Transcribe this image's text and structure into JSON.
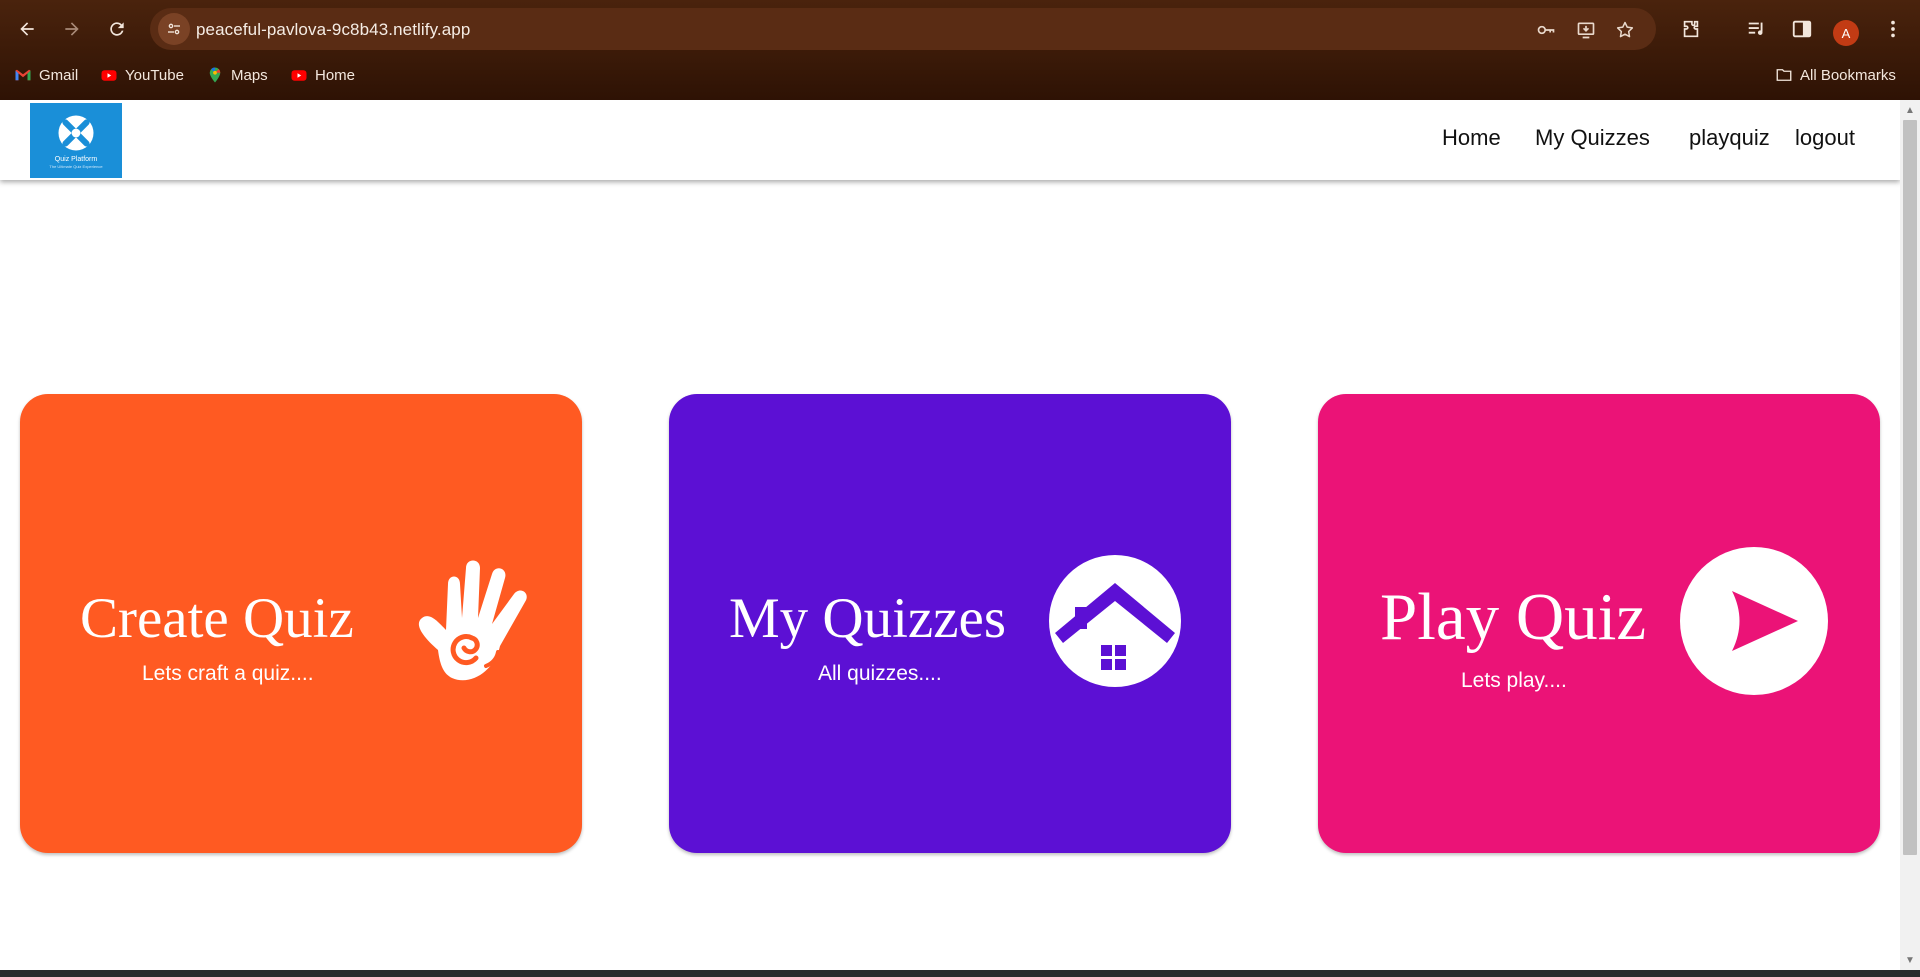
{
  "browser": {
    "url": "peaceful-pavlova-9c8b43.netlify.app",
    "avatar_letter": "A",
    "bookmarks": [
      {
        "label": "Gmail",
        "icon": "gmail-icon"
      },
      {
        "label": "YouTube",
        "icon": "youtube-icon"
      },
      {
        "label": "Maps",
        "icon": "maps-icon"
      },
      {
        "label": "Home",
        "icon": "youtube-icon"
      }
    ],
    "all_bookmarks_label": "All Bookmarks"
  },
  "header": {
    "logo_text": "Quiz Platform",
    "logo_tagline": "The Ultimate Quiz Experience",
    "nav": [
      {
        "label": "Home"
      },
      {
        "label": "My Quizzes"
      },
      {
        "label": "playquiz"
      },
      {
        "label": "logout"
      }
    ]
  },
  "cards": [
    {
      "title": "Create Quiz",
      "subtitle": "Lets craft a quiz....",
      "color": "#ff5a22",
      "icon": "hand-icon"
    },
    {
      "title": "My Quizzes",
      "subtitle": "All quizzes....",
      "color": "#5c10d4",
      "icon": "home-icon"
    },
    {
      "title": "Play Quiz",
      "subtitle": "Lets play....",
      "color": "#eb1377",
      "icon": "play-icon"
    }
  ]
}
